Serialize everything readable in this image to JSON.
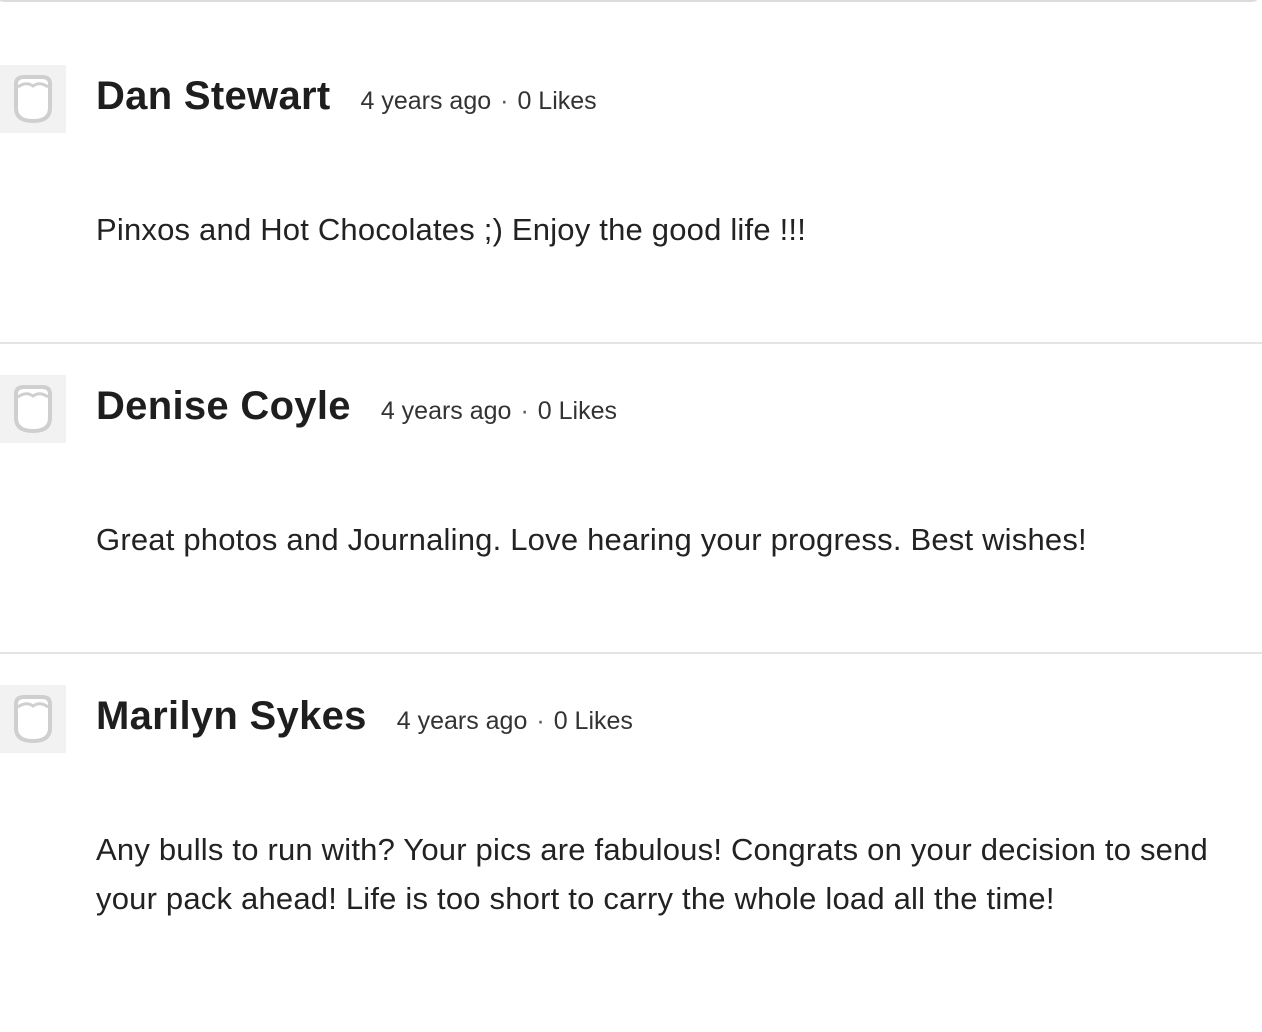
{
  "comments": [
    {
      "author": "Dan Stewart",
      "time": "4 years ago",
      "separator": "·",
      "likes": "0 Likes",
      "text": "Pinxos and Hot Chocolates ;) Enjoy the good life !!!"
    },
    {
      "author": "Denise Coyle",
      "time": "4 years ago",
      "separator": "·",
      "likes": "0 Likes",
      "text": "Great photos and Journaling. Love hearing your progress. Best wishes!"
    },
    {
      "author": "Marilyn Sykes",
      "time": "4 years ago",
      "separator": "·",
      "likes": "0 Likes",
      "text": "Any bulls to run with? Your pics are fabulous! Congrats on your decision to send your pack ahead! Life is too short to carry the whole load all the time!"
    }
  ],
  "colors": {
    "avatar_bg": "#f2f2f2",
    "avatar_stroke": "#cfcfcf",
    "divider": "#e4e4e4"
  },
  "icons": {
    "avatar": "default-avatar-icon"
  }
}
